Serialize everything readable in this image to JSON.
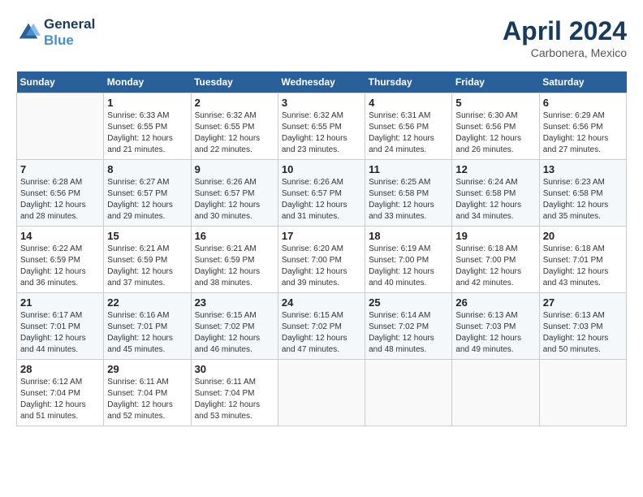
{
  "header": {
    "logo_line1": "General",
    "logo_line2": "Blue",
    "month": "April 2024",
    "location": "Carbonera, Mexico"
  },
  "days_of_week": [
    "Sunday",
    "Monday",
    "Tuesday",
    "Wednesday",
    "Thursday",
    "Friday",
    "Saturday"
  ],
  "weeks": [
    [
      {
        "day": "",
        "info": ""
      },
      {
        "day": "1",
        "info": "Sunrise: 6:33 AM\nSunset: 6:55 PM\nDaylight: 12 hours\nand 21 minutes."
      },
      {
        "day": "2",
        "info": "Sunrise: 6:32 AM\nSunset: 6:55 PM\nDaylight: 12 hours\nand 22 minutes."
      },
      {
        "day": "3",
        "info": "Sunrise: 6:32 AM\nSunset: 6:55 PM\nDaylight: 12 hours\nand 23 minutes."
      },
      {
        "day": "4",
        "info": "Sunrise: 6:31 AM\nSunset: 6:56 PM\nDaylight: 12 hours\nand 24 minutes."
      },
      {
        "day": "5",
        "info": "Sunrise: 6:30 AM\nSunset: 6:56 PM\nDaylight: 12 hours\nand 26 minutes."
      },
      {
        "day": "6",
        "info": "Sunrise: 6:29 AM\nSunset: 6:56 PM\nDaylight: 12 hours\nand 27 minutes."
      }
    ],
    [
      {
        "day": "7",
        "info": "Sunrise: 6:28 AM\nSunset: 6:56 PM\nDaylight: 12 hours\nand 28 minutes."
      },
      {
        "day": "8",
        "info": "Sunrise: 6:27 AM\nSunset: 6:57 PM\nDaylight: 12 hours\nand 29 minutes."
      },
      {
        "day": "9",
        "info": "Sunrise: 6:26 AM\nSunset: 6:57 PM\nDaylight: 12 hours\nand 30 minutes."
      },
      {
        "day": "10",
        "info": "Sunrise: 6:26 AM\nSunset: 6:57 PM\nDaylight: 12 hours\nand 31 minutes."
      },
      {
        "day": "11",
        "info": "Sunrise: 6:25 AM\nSunset: 6:58 PM\nDaylight: 12 hours\nand 33 minutes."
      },
      {
        "day": "12",
        "info": "Sunrise: 6:24 AM\nSunset: 6:58 PM\nDaylight: 12 hours\nand 34 minutes."
      },
      {
        "day": "13",
        "info": "Sunrise: 6:23 AM\nSunset: 6:58 PM\nDaylight: 12 hours\nand 35 minutes."
      }
    ],
    [
      {
        "day": "14",
        "info": "Sunrise: 6:22 AM\nSunset: 6:59 PM\nDaylight: 12 hours\nand 36 minutes."
      },
      {
        "day": "15",
        "info": "Sunrise: 6:21 AM\nSunset: 6:59 PM\nDaylight: 12 hours\nand 37 minutes."
      },
      {
        "day": "16",
        "info": "Sunrise: 6:21 AM\nSunset: 6:59 PM\nDaylight: 12 hours\nand 38 minutes."
      },
      {
        "day": "17",
        "info": "Sunrise: 6:20 AM\nSunset: 7:00 PM\nDaylight: 12 hours\nand 39 minutes."
      },
      {
        "day": "18",
        "info": "Sunrise: 6:19 AM\nSunset: 7:00 PM\nDaylight: 12 hours\nand 40 minutes."
      },
      {
        "day": "19",
        "info": "Sunrise: 6:18 AM\nSunset: 7:00 PM\nDaylight: 12 hours\nand 42 minutes."
      },
      {
        "day": "20",
        "info": "Sunrise: 6:18 AM\nSunset: 7:01 PM\nDaylight: 12 hours\nand 43 minutes."
      }
    ],
    [
      {
        "day": "21",
        "info": "Sunrise: 6:17 AM\nSunset: 7:01 PM\nDaylight: 12 hours\nand 44 minutes."
      },
      {
        "day": "22",
        "info": "Sunrise: 6:16 AM\nSunset: 7:01 PM\nDaylight: 12 hours\nand 45 minutes."
      },
      {
        "day": "23",
        "info": "Sunrise: 6:15 AM\nSunset: 7:02 PM\nDaylight: 12 hours\nand 46 minutes."
      },
      {
        "day": "24",
        "info": "Sunrise: 6:15 AM\nSunset: 7:02 PM\nDaylight: 12 hours\nand 47 minutes."
      },
      {
        "day": "25",
        "info": "Sunrise: 6:14 AM\nSunset: 7:02 PM\nDaylight: 12 hours\nand 48 minutes."
      },
      {
        "day": "26",
        "info": "Sunrise: 6:13 AM\nSunset: 7:03 PM\nDaylight: 12 hours\nand 49 minutes."
      },
      {
        "day": "27",
        "info": "Sunrise: 6:13 AM\nSunset: 7:03 PM\nDaylight: 12 hours\nand 50 minutes."
      }
    ],
    [
      {
        "day": "28",
        "info": "Sunrise: 6:12 AM\nSunset: 7:04 PM\nDaylight: 12 hours\nand 51 minutes."
      },
      {
        "day": "29",
        "info": "Sunrise: 6:11 AM\nSunset: 7:04 PM\nDaylight: 12 hours\nand 52 minutes."
      },
      {
        "day": "30",
        "info": "Sunrise: 6:11 AM\nSunset: 7:04 PM\nDaylight: 12 hours\nand 53 minutes."
      },
      {
        "day": "",
        "info": ""
      },
      {
        "day": "",
        "info": ""
      },
      {
        "day": "",
        "info": ""
      },
      {
        "day": "",
        "info": ""
      }
    ]
  ]
}
